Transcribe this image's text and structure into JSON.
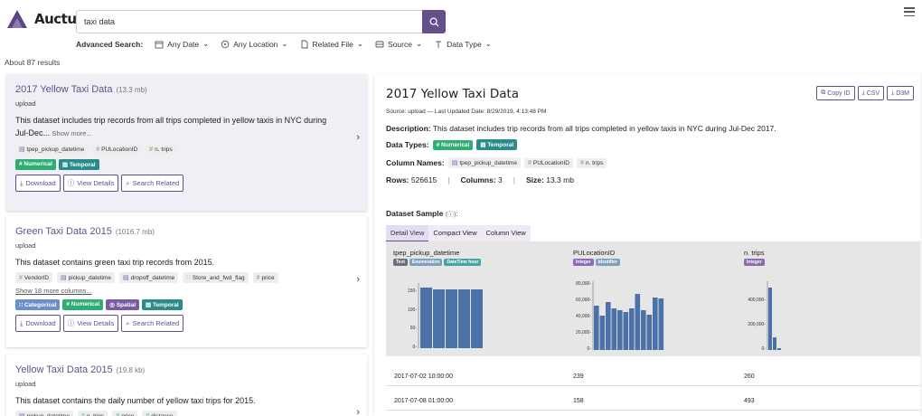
{
  "header": {
    "logo_text": "Auctus",
    "search_value": "taxi data",
    "advanced_label": "Advanced Search:",
    "filters": [
      "Any Date",
      "Any Location",
      "Related File",
      "Source",
      "Data Type"
    ]
  },
  "results_count": "About 87 results",
  "results": [
    {
      "title": "2017 Yellow Taxi Data",
      "size": "(13.3 mb)",
      "source": "upload",
      "desc": "This dataset includes trip records from all trips completed in yellow taxis in NYC during Jul-Dec...",
      "more": "Show more...",
      "columns": [
        "tpep_pickup_datetime",
        "PULocationID",
        "n. trips"
      ],
      "types": [
        "Numerical",
        "Temporal"
      ]
    },
    {
      "title": "Green Taxi Data 2015",
      "size": "(1016.7 mb)",
      "source": "upload",
      "desc": "This dataset contains green taxi trip records from 2015.",
      "more": "Show 18 more columns...",
      "columns": [
        "VendorID",
        "pickup_datetime",
        "dropoff_datetime",
        "Store_and_fwd_flag",
        "price"
      ],
      "types": [
        "Categorical",
        "Numerical",
        "Spatial",
        "Temporal"
      ]
    },
    {
      "title": "Yellow Taxi Data 2015",
      "size": "(19.8 kb)",
      "source": "upload",
      "desc": "This dataset contains the daily number of yellow taxi trips for 2015.",
      "columns": [
        "pickup_datetime",
        "n_trips",
        "price",
        "distance"
      ]
    }
  ],
  "actions": {
    "download": "Download",
    "view": "View Details",
    "related": "Search Related"
  },
  "detail": {
    "title": "2017 Yellow Taxi Data",
    "buttons": [
      "Copy ID",
      "CSV",
      "D3M"
    ],
    "source_line": "Source: upload — Last Updated Date: 8/29/2019, 4:13:48 PM",
    "desc_label": "Description:",
    "desc": "This dataset includes trip records from all trips completed in yellow taxis in NYC during Jul-Dec 2017.",
    "types_label": "Data Types:",
    "types": [
      "Numerical",
      "Temporal"
    ],
    "colnames_label": "Column Names:",
    "columns": [
      "tpep_pickup_datetime",
      "PULocationID",
      "n. trips"
    ],
    "rows_label": "Rows:",
    "rows": "526615",
    "cols_label": "Columns:",
    "cols": "3",
    "size_label": "Size:",
    "size": "13.3 mb",
    "sample_label": "Dataset Sample",
    "views": [
      "Detail View",
      "Compact View",
      "Column View"
    ],
    "sample_columns": [
      {
        "name": "tpep_pickup_datetime",
        "tags": [
          "Text",
          "Enumeration",
          "DateTime hour"
        ],
        "ticks": [
          "150-",
          "100-",
          "50-",
          "0-"
        ]
      },
      {
        "name": "PULocationID",
        "tags": [
          "Integer",
          "Identifier"
        ],
        "ticks": [
          "80,000-",
          "60,000-",
          "40,000-",
          "20,000-",
          "0-"
        ]
      },
      {
        "name": "n. trips",
        "tags": [
          "Integer"
        ],
        "ticks": [
          "400,000-",
          "200,000-",
          "0-"
        ]
      }
    ],
    "sample_rows": [
      [
        "2017-07-02 10:00:00",
        "239",
        "260"
      ],
      [
        "2017-07-08 01:00:00",
        "158",
        "493"
      ]
    ]
  },
  "colors": {
    "accent": "#63508b",
    "green": "#2eae74",
    "teal": "#2a8b8b",
    "bar": "#4a72a8"
  }
}
